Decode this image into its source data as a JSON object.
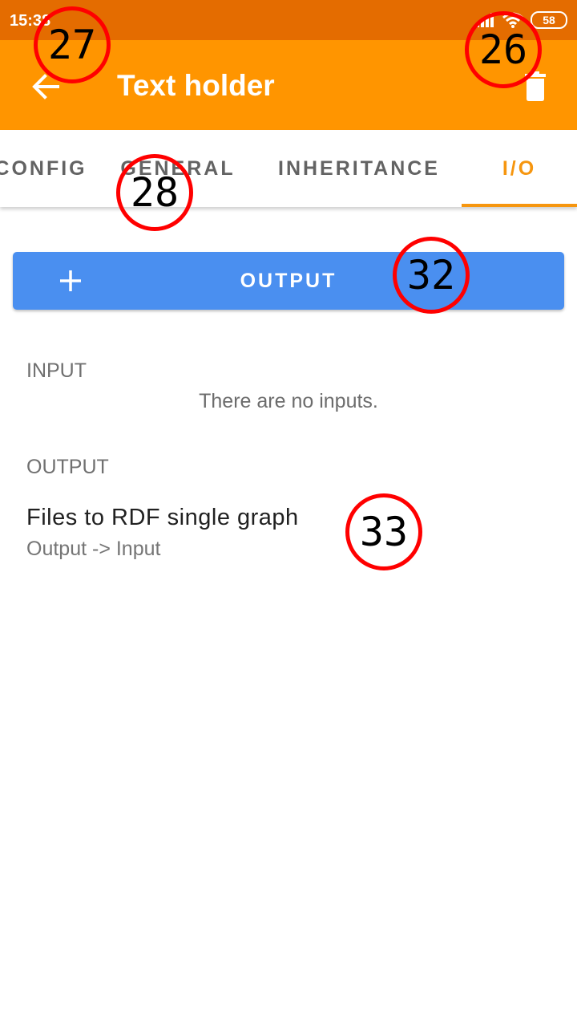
{
  "status_bar": {
    "time": "15:38",
    "battery": "58"
  },
  "app_bar": {
    "title": "Text holder",
    "back_icon": "arrow-back-icon",
    "delete_icon": "trash-icon"
  },
  "tabs": [
    {
      "label": "CONFIG",
      "active": false
    },
    {
      "label": "GENERAL",
      "active": false
    },
    {
      "label": "INHERITANCE",
      "active": false
    },
    {
      "label": "I/O",
      "active": true
    }
  ],
  "output_button": {
    "label": "OUTPUT",
    "icon": "plus-icon"
  },
  "input_section": {
    "label": "INPUT",
    "empty_message": "There are no inputs."
  },
  "output_section": {
    "label": "OUTPUT",
    "items": [
      {
        "title": "Files to RDF single graph",
        "subtitle": "Output -> Input"
      }
    ]
  },
  "markers": [
    "27",
    "26",
    "28",
    "32",
    "33"
  ],
  "colors": {
    "status_bar": "#e46c00",
    "app_bar": "#ff9500",
    "accent": "#f6960f",
    "button": "#4a8ff0",
    "marker": "#ff0000"
  }
}
